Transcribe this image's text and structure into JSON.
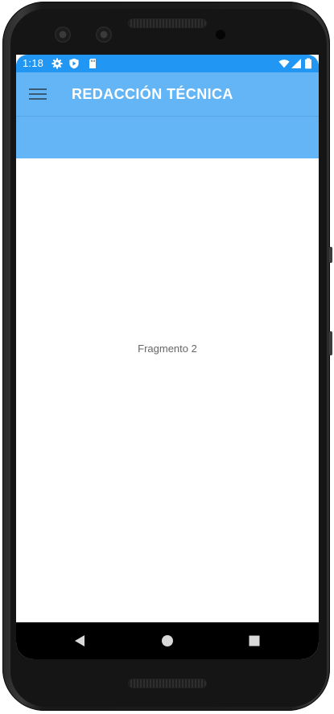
{
  "status_bar": {
    "time": "1:18",
    "left_icons": [
      "settings-icon",
      "play-protect-icon",
      "sd-card-icon"
    ],
    "right_icons": [
      "wifi-icon",
      "cell-signal-icon",
      "battery-icon"
    ],
    "color": "#2196f3"
  },
  "app_bar": {
    "title": "REDACCIÓN TÉCNICA",
    "menu_icon": "hamburger-menu-icon",
    "color": "#64b5f6"
  },
  "content": {
    "fragment_label": "Fragmento 2"
  },
  "nav_bar": {
    "buttons": [
      "back-icon",
      "home-icon",
      "recents-icon"
    ]
  }
}
